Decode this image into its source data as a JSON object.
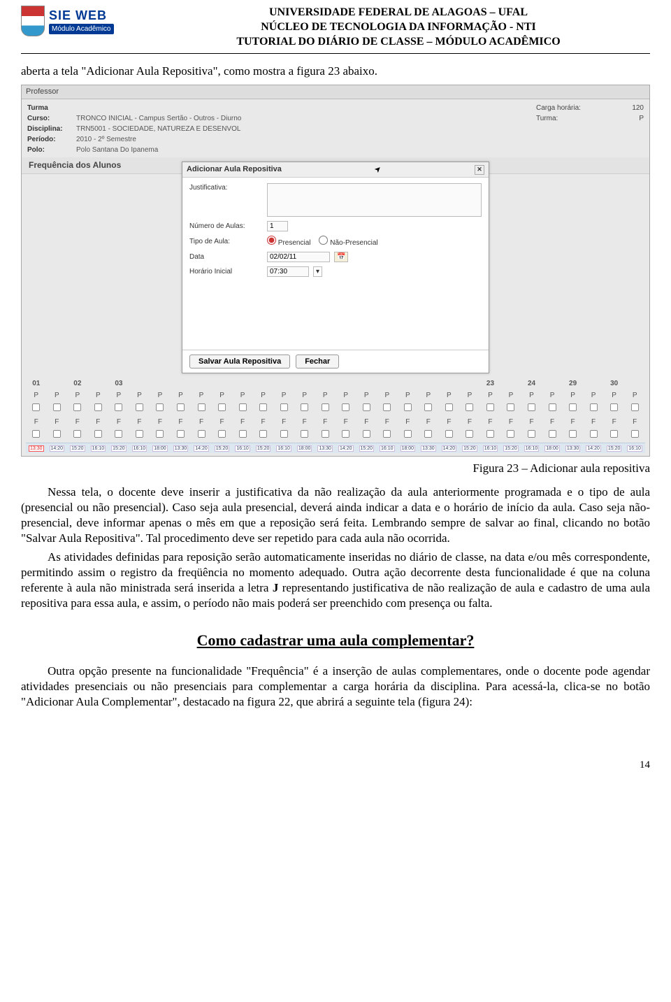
{
  "header": {
    "sieweb_line1": "SIE WEB",
    "sieweb_line2": "Módulo Acadêmico",
    "title1": "UNIVERSIDADE FEDERAL DE ALAGOAS – UFAL",
    "title2": "NÚCLEO DE TECNOLOGIA DA INFORMAÇÃO - NTI",
    "title3": "TUTORIAL DO DIÁRIO DE CLASSE – MÓDULO ACADÊMICO"
  },
  "intro_line": "aberta a tela \"Adicionar Aula Repositiva\", como mostra a figura 23 abaixo.",
  "screenshot": {
    "toolbar": "Professor",
    "info": {
      "turma_lbl": "Turma",
      "curso_lbl": "Curso:",
      "curso_val": "TRONCO INICIAL - Campus Sertão - Outros - Diurno",
      "disc_lbl": "Disciplina:",
      "disc_val": "TRN5001 - SOCIEDADE, NATUREZA E DESENVOL",
      "per_lbl": "Período:",
      "per_val": "2010 - 2º Semestre",
      "polo_lbl": "Polo:",
      "polo_val": "Polo Santana Do Ipanema"
    },
    "rhs": {
      "ch_lbl": "Carga horária:",
      "ch_val": "120",
      "turma_lbl": "Turma:",
      "turma_val": "P"
    },
    "subhead": "Frequência dos Alunos",
    "modal": {
      "title": "Adicionar Aula Repositiva",
      "just_lbl": "Justificativa:",
      "naulas_lbl": "Número de Aulas:",
      "naulas_val": "1",
      "tipo_lbl": "Tipo de Aula:",
      "tipo_opt1": "Presencial",
      "tipo_opt2": "Não-Presencial",
      "data_lbl": "Data",
      "data_val": "02/02/11",
      "hini_lbl": "Horário Inicial",
      "hini_val": "07:30",
      "btn_save": "Salvar Aula Repositiva",
      "btn_close": "Fechar"
    },
    "grid": {
      "headers_left": [
        "01",
        "02",
        "03"
      ],
      "headers_right": [
        "23",
        "24",
        "29",
        "30"
      ],
      "p_label": "P",
      "f_label": "F",
      "range_cells": [
        "13:30",
        "14:20",
        "15:20",
        "16:10",
        "15:20",
        "16:10",
        "18:00",
        "13:30",
        "14:20",
        "15:20",
        "16:10",
        "15:20",
        "16:10",
        "18:00",
        "13:30",
        "14:20",
        "15:20",
        "16:10",
        "18:00",
        "13:30",
        "14:20",
        "15:20",
        "16:10",
        "15:20",
        "16:10",
        "18:00",
        "13:30",
        "14:20",
        "15:20",
        "16:10"
      ]
    }
  },
  "figure_caption": "Figura 23 – Adicionar aula repositiva",
  "para1": "Nessa tela, o docente deve inserir a justificativa da não realização da aula anteriormente programada e o tipo de aula (presencial ou não presencial). Caso seja aula presencial, deverá ainda indicar a data e o horário de início da aula. Caso seja não-presencial, deve informar apenas o mês em que a reposição será feita. Lembrando sempre de salvar ao final, clicando no botão \"Salvar Aula Repositiva\". Tal procedimento deve ser repetido para cada aula não ocorrida.",
  "para2a": "As atividades definidas para reposição serão automaticamente inseridas no diário de classe, na data e/ou mês correspondente, permitindo assim o registro da freqüência no momento adequado. Outra ação decorrente desta funcionalidade é que na coluna referente à aula não ministrada será inserida a letra ",
  "para2_j": "J",
  "para2b": " representando justificativa de não realização de aula e cadastro de uma aula repositiva para essa aula, e assim, o período não mais poderá ser preenchido com presença ou falta.",
  "section_title": "Como cadastrar uma aula complementar?",
  "para3": "Outra opção presente na funcionalidade \"Frequência\" é a inserção de aulas complementares, onde o docente pode agendar atividades presenciais ou não presenciais para complementar a carga horária da disciplina. Para acessá-la, clica-se no botão \"Adicionar Aula Complementar\", destacado na figura 22, que abrirá a seguinte tela (figura 24):",
  "page_number": "14"
}
